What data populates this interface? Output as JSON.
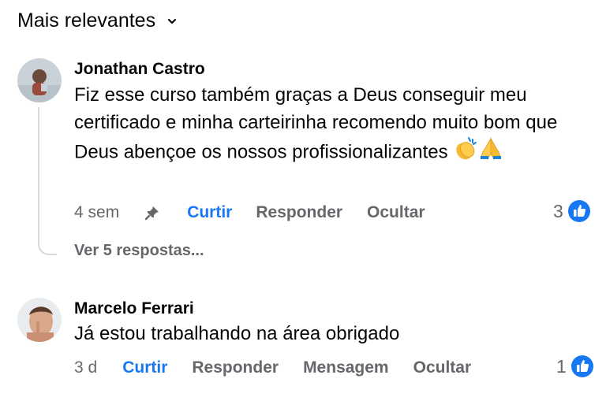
{
  "sort": {
    "label": "Mais relevantes"
  },
  "comments": [
    {
      "author": "Jonathan Castro",
      "text": "Fiz esse curso também graças a Deus conseguir meu certificado e minha carteirinha recomendo muito bom que Deus abençoe os nossos profissionalizantes",
      "emojis": [
        "clapping-hands",
        "folded-hands"
      ],
      "time": "4 sem",
      "actions": [
        "Curtir",
        "Responder",
        "Ocultar"
      ],
      "likes": "3",
      "view_replies": "Ver 5 respostas..."
    },
    {
      "author": "Marcelo Ferrari",
      "text": "Já estou trabalhando na área obrigado",
      "time": "3 d",
      "actions": [
        "Curtir",
        "Responder",
        "Mensagem",
        "Ocultar"
      ],
      "likes": "1"
    }
  ],
  "colors": {
    "accent": "#1877f2",
    "muted": "#65676b",
    "text": "#050505"
  }
}
